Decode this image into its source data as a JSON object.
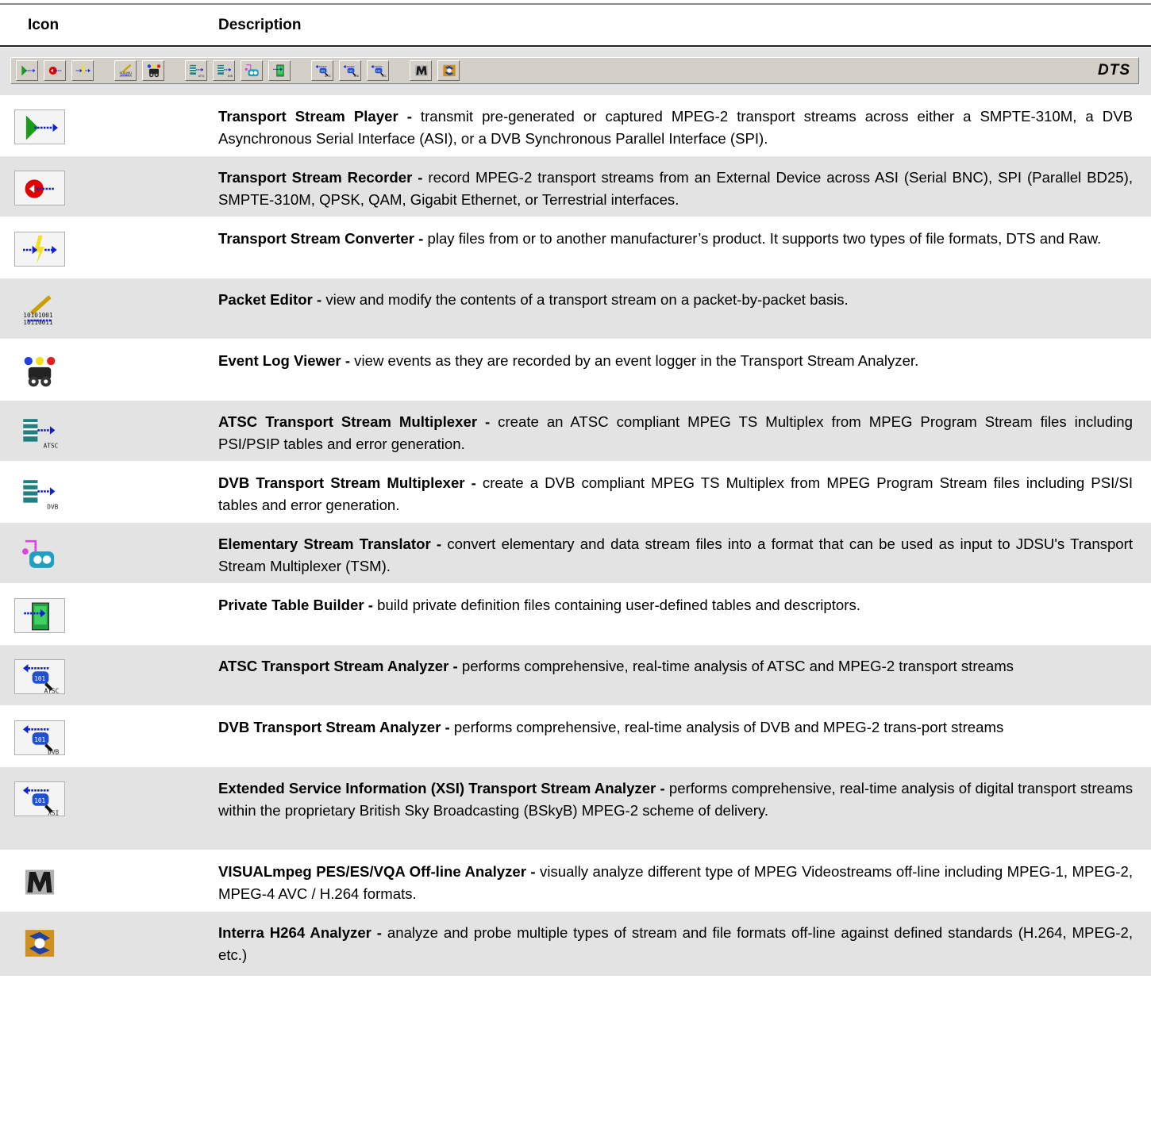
{
  "header": {
    "icon_col": "Icon",
    "description_col": "Description"
  },
  "toolbar": {
    "logo": "DTS",
    "buttons": [
      {
        "name": "player-icon"
      },
      {
        "name": "recorder-icon"
      },
      {
        "name": "converter-icon"
      },
      {
        "name": "packet-editor-icon"
      },
      {
        "name": "event-log-icon"
      },
      {
        "name": "atsc-mux-icon"
      },
      {
        "name": "dvb-mux-icon"
      },
      {
        "name": "est-icon"
      },
      {
        "name": "table-builder-icon"
      },
      {
        "name": "atsc-analyzer-icon"
      },
      {
        "name": "dvb-analyzer-icon"
      },
      {
        "name": "xsi-analyzer-icon"
      },
      {
        "name": "visualmpeg-icon"
      },
      {
        "name": "interra-icon"
      }
    ]
  },
  "rows": [
    {
      "title": "Transport Stream Player -",
      "text": " transmit pre-generated or captured MPEG-2 transport streams across either a SMPTE-310M, a DVB Asynchronous Serial Interface (ASI), or a DVB Synchronous Parallel Interface (SPI).",
      "icon": "player-icon"
    },
    {
      "title": "Transport Stream Recorder -",
      "text": " record MPEG-2 transport streams from an External Device across ASI (Serial BNC), SPI (Parallel BD25), SMPTE-310M, QPSK, QAM, Gigabit Ethernet, or Terrestrial interfaces.",
      "icon": "recorder-icon"
    },
    {
      "title": "Transport Stream Converter -",
      "text": " play files from or to another manufacturer’s product. It supports two types of file formats, DTS and Raw.",
      "icon": "converter-icon"
    },
    {
      "title": "Packet Editor -",
      "text": " view and modify the contents of a transport stream on a packet-by-packet basis.",
      "icon": "packet-editor-icon"
    },
    {
      "title": "Event Log Viewer -",
      "text": " view events as they are recorded by an event logger in the Transport Stream Analyzer.",
      "icon": "event-log-icon"
    },
    {
      "title": "ATSC Transport Stream Multiplexer -",
      "text": " create an ATSC compliant MPEG TS Multiplex from MPEG Program Stream files including PSI/PSIP tables and error generation.",
      "icon": "atsc-mux-icon",
      "label": "ATSC"
    },
    {
      "title": "DVB Transport Stream Multiplexer -",
      "text": " create a DVB compliant MPEG TS Multiplex from MPEG Program Stream files including PSI/SI tables and error generation.",
      "icon": "dvb-mux-icon",
      "label": "DVB"
    },
    {
      "title": "Elementary Stream Translator -",
      "text": " convert elementary and data stream files into a format that can be used as input to JDSU's Transport Stream Multiplexer (TSM).",
      "icon": "est-icon"
    },
    {
      "title": "Private Table Builder -",
      "text": " build private definition files containing user-defined tables and descriptors.",
      "icon": "table-builder-icon"
    },
    {
      "title": "ATSC Transport Stream Analyzer -",
      "text": " performs comprehensive, real-time analysis of ATSC and MPEG-2 transport streams",
      "icon": "atsc-analyzer-icon",
      "label": "ATSC"
    },
    {
      "title": "DVB Transport Stream Analyzer -",
      "text": " performs comprehensive, real-time analysis of DVB and MPEG-2 trans-port streams",
      "icon": "dvb-analyzer-icon",
      "label": "DVB"
    },
    {
      "title": "Extended Service Information (XSI) Transport Stream Analyzer -",
      "text": " performs comprehensive, real-time analysis of digital transport streams within the proprietary British Sky Broadcasting (BSkyB) MPEG-2 scheme of delivery.",
      "icon": "xsi-analyzer-icon",
      "label": "XSI"
    },
    {
      "title": "VISUALmpeg PES/ES/VQA Off-line Analyzer -",
      "text": " visually analyze different type of MPEG Videostreams off-line including MPEG-1, MPEG-2, MPEG-4 AVC / H.264 formats.",
      "icon": "visualmpeg-icon"
    },
    {
      "title": "Interra H264 Analyzer -",
      "text": " analyze and probe multiple types of stream and file formats off-line against defined standards (H.264, MPEG-2, etc.)",
      "icon": "interra-icon"
    }
  ]
}
